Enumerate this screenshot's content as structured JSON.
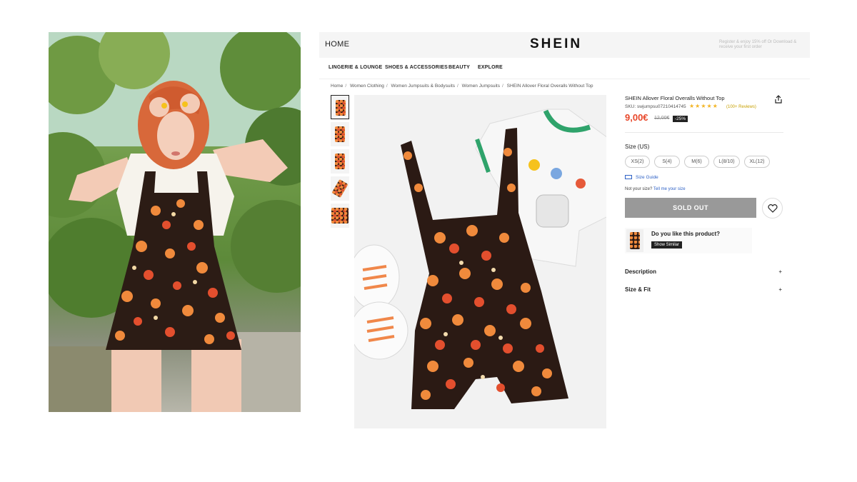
{
  "site": {
    "home_label": "HOME",
    "brand": "SHEIN",
    "promo": "Register & enjoy 15% off Or Download & receive your first order"
  },
  "nav": {
    "items": [
      "LINGERIE & LOUNGE",
      "SHOES & ACCESSORIES",
      "BEAUTY",
      "EXPLORE"
    ]
  },
  "breadcrumb": [
    "Home",
    "Women Clothing",
    "Women Jumpsuits & Bodysuits",
    "Women Jumpsuits",
    "SHEIN Allover Floral Overalls Without Top"
  ],
  "product": {
    "title": "SHEIN Allover Floral Overalls Without Top",
    "sku": "SKU: swjumpsu07210414745",
    "rating_stars": "★★★★★",
    "reviews": "(100+ Reviews)",
    "price": "9,00€",
    "old_price": "12,00€",
    "discount": "-25%",
    "size_label": "Size (US)",
    "sizes": [
      "XS(2)",
      "S(4)",
      "M(6)",
      "L(8/10)",
      "XL(12)"
    ],
    "size_guide": "Size Guide",
    "not_your_size": "Not your size?",
    "tell_me_size": "Tell me your size",
    "sold_out": "SOLD OUT",
    "like_prompt": "Do you like this product?",
    "show_similar": "Show Similar",
    "description": "Description",
    "size_fit": "Size & Fit",
    "accordion_icon": "+"
  },
  "icons": {
    "share": "share-icon",
    "wishlist": "heart-icon",
    "ruler": "ruler-icon"
  },
  "colors": {
    "price": "#e8472a",
    "sold_out_bg": "#999999",
    "link": "#2f62c6",
    "stars": "#f3b526"
  }
}
